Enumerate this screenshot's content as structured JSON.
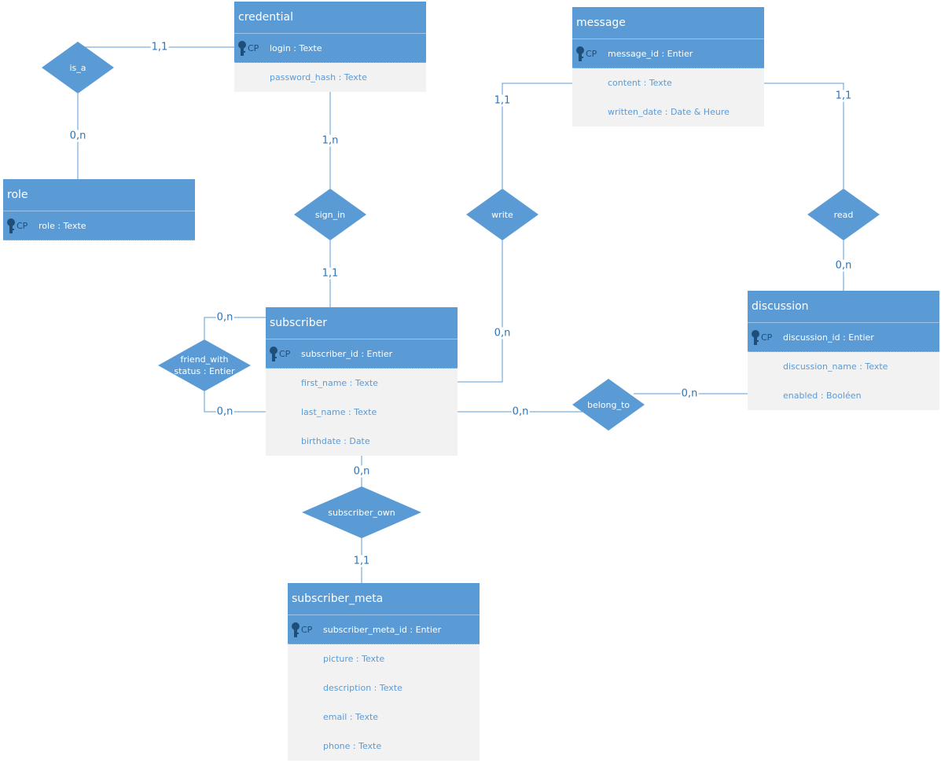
{
  "colors": {
    "entity_header": "#5b9bd5",
    "attribute_row": "#f2f2f2",
    "attribute_text": "#5b9bd5",
    "line": "#5b9bd5",
    "cardinality_text": "#2e75b6",
    "key_icon": "#1f4e79"
  },
  "key_marker": "CP",
  "entities": [
    {
      "id": "credential",
      "name": "credential",
      "key": "login : Texte",
      "attributes": [
        "password_hash : Texte"
      ]
    },
    {
      "id": "role",
      "name": "role",
      "key": "role : Texte",
      "attributes": []
    },
    {
      "id": "message",
      "name": "message",
      "key": "message_id : Entier",
      "attributes": [
        "content : Texte",
        "written_date : Date & Heure"
      ]
    },
    {
      "id": "discussion",
      "name": "discussion",
      "key": "discussion_id : Entier",
      "attributes": [
        "discussion_name : Texte",
        "enabled : Booléen"
      ]
    },
    {
      "id": "subscriber",
      "name": "subscriber",
      "key": "subscriber_id : Entier",
      "attributes": [
        "first_name : Texte",
        "last_name : Texte",
        "birthdate : Date"
      ]
    },
    {
      "id": "subscriber_meta",
      "name": "subscriber_meta",
      "key": "subscriber_meta_id : Entier",
      "attributes": [
        "picture : Texte",
        "description : Texte",
        "email : Texte",
        "phone : Texte"
      ]
    }
  ],
  "relationships": [
    {
      "id": "is_a",
      "name": "is_a",
      "lines": [
        "is_a"
      ]
    },
    {
      "id": "sign_in",
      "name": "sign_in",
      "lines": [
        "sign_in"
      ]
    },
    {
      "id": "write",
      "name": "write",
      "lines": [
        "write"
      ]
    },
    {
      "id": "read",
      "name": "read",
      "lines": [
        "read"
      ]
    },
    {
      "id": "friend_with",
      "name": "friend_with",
      "lines": [
        "friend_with",
        "status : Entier"
      ]
    },
    {
      "id": "belong_to",
      "name": "belong_to",
      "lines": [
        "belong_to"
      ]
    },
    {
      "id": "subscriber_own",
      "name": "subscriber_own",
      "lines": [
        "subscriber_own"
      ]
    }
  ],
  "links": [
    {
      "id": "credential-is_a",
      "from": "credential",
      "to": "is_a",
      "cardinality": "1,1"
    },
    {
      "id": "role-is_a",
      "from": "role",
      "to": "is_a",
      "cardinality": "0,n"
    },
    {
      "id": "credential-sign_in",
      "from": "credential",
      "to": "sign_in",
      "cardinality": "1,n"
    },
    {
      "id": "subscriber-sign_in",
      "from": "subscriber",
      "to": "sign_in",
      "cardinality": "1,1"
    },
    {
      "id": "message-write",
      "from": "message",
      "to": "write",
      "cardinality": "1,1"
    },
    {
      "id": "subscriber-write",
      "from": "subscriber",
      "to": "write",
      "cardinality": "0,n"
    },
    {
      "id": "message-read",
      "from": "message",
      "to": "read",
      "cardinality": "1,1"
    },
    {
      "id": "discussion-read",
      "from": "discussion",
      "to": "read",
      "cardinality": "0,n"
    },
    {
      "id": "subscriber-friend_with-1",
      "from": "subscriber",
      "to": "friend_with",
      "cardinality": "0,n"
    },
    {
      "id": "subscriber-friend_with-2",
      "from": "subscriber",
      "to": "friend_with",
      "cardinality": "0,n"
    },
    {
      "id": "subscriber-belong_to",
      "from": "subscriber",
      "to": "belong_to",
      "cardinality": "0,n"
    },
    {
      "id": "discussion-belong_to",
      "from": "discussion",
      "to": "belong_to",
      "cardinality": "0,n"
    },
    {
      "id": "subscriber-subscriber_own",
      "from": "subscriber",
      "to": "subscriber_own",
      "cardinality": "0,n"
    },
    {
      "id": "subscriber_meta-subscriber_own",
      "from": "subscriber_meta",
      "to": "subscriber_own",
      "cardinality": "1,1"
    }
  ]
}
